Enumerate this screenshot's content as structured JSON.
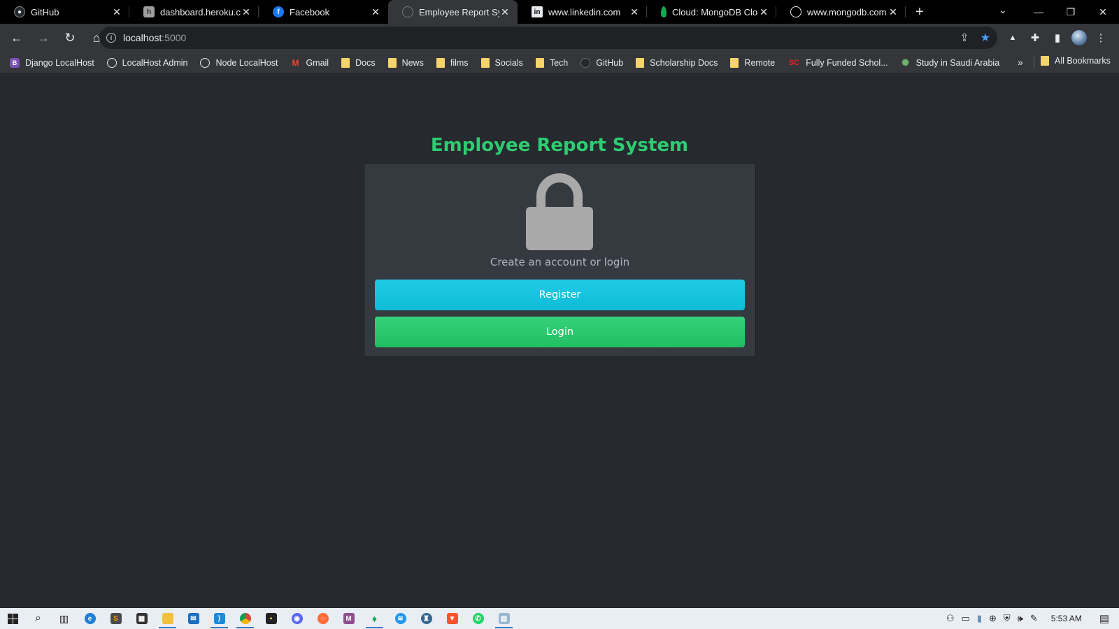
{
  "browser": {
    "tabs": [
      {
        "label": "GitHub",
        "icon": "github-icon",
        "color": "#24292e"
      },
      {
        "label": "dashboard.heroku.com",
        "icon": "heroku-icon",
        "color": "#9e9e9e"
      },
      {
        "label": "Facebook",
        "icon": "facebook-icon",
        "color": "#1877f2"
      },
      {
        "label": "Employee Report Syste",
        "icon": "globe-icon",
        "color": "#6b6b6b",
        "active": true
      },
      {
        "label": "www.linkedin.com",
        "icon": "linkedin-icon",
        "color": "#0a66c2"
      },
      {
        "label": "Cloud: MongoDB Clou",
        "icon": "mongodb-icon",
        "color": "#13aa52"
      },
      {
        "label": "www.mongodb.com",
        "icon": "globe-icon",
        "color": "#6b6b6b"
      }
    ],
    "new_tab": "+",
    "address": {
      "host": "localhost",
      "port": ":5000"
    },
    "bookmarks": [
      {
        "label": "Django LocalHost",
        "icon": "bootstrap-icon"
      },
      {
        "label": "LocalHost Admin",
        "icon": "globe-icon"
      },
      {
        "label": "Node LocalHost",
        "icon": "globe-icon"
      },
      {
        "label": "Gmail",
        "icon": "gmail-icon"
      },
      {
        "label": "Docs",
        "icon": "folder-icon"
      },
      {
        "label": "News",
        "icon": "folder-icon"
      },
      {
        "label": "films",
        "icon": "folder-icon"
      },
      {
        "label": "Socials",
        "icon": "folder-icon"
      },
      {
        "label": "Tech",
        "icon": "folder-icon"
      },
      {
        "label": "GitHub",
        "icon": "github-icon"
      },
      {
        "label": "Scholarship Docs",
        "icon": "folder-icon"
      },
      {
        "label": "Remote",
        "icon": "folder-icon"
      },
      {
        "label": "Fully Funded Schol...",
        "icon": "sc-icon"
      },
      {
        "label": "Study in Saudi Arabia",
        "icon": "sun-icon"
      }
    ],
    "bookmarks_more": "»",
    "all_bookmarks": "All Bookmarks"
  },
  "page": {
    "title": "Employee Report System",
    "subtitle": "Create an account or login",
    "register_label": "Register",
    "login_label": "Login"
  },
  "taskbar": {
    "time": "5:53 AM"
  },
  "colors": {
    "accent_green": "#2ecc71",
    "register_cyan": "#17c1dc",
    "login_green": "#28c76a",
    "page_bg": "#262a2f",
    "card_bg": "#343a40"
  }
}
